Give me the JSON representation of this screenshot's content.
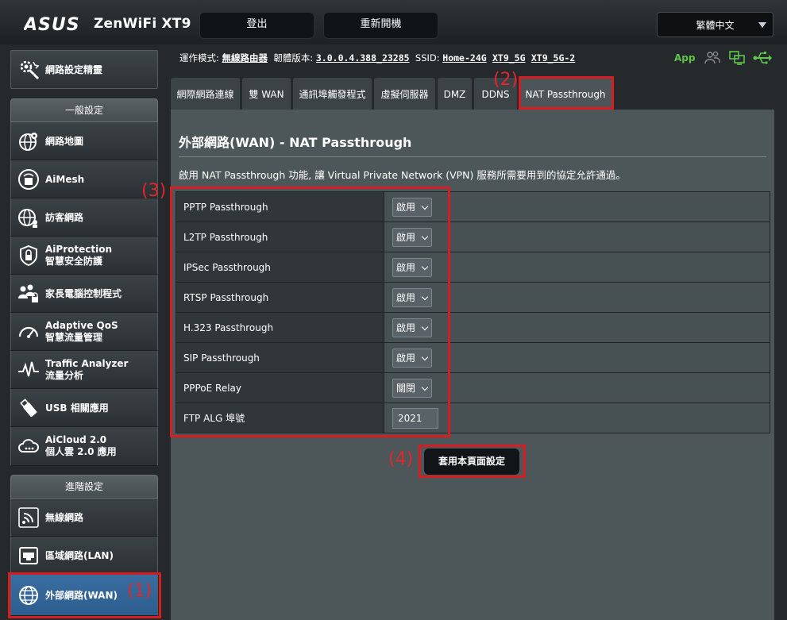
{
  "header": {
    "brand": "ASUS",
    "model": "ZenWiFi XT9",
    "logout_label": "登出",
    "reboot_label": "重新開機",
    "language": "繁體中文"
  },
  "info": {
    "mode_label": "運作模式:",
    "mode_value": "無線路由器",
    "firmware_label": "韌體版本:",
    "firmware_value": "3.0.0.4.388_23285",
    "ssid_label": "SSID:",
    "ssids": [
      "Home-24G",
      "XT9_5G",
      "XT9_5G-2"
    ],
    "app_label": "App"
  },
  "sidebar": {
    "quick_setup": "網路設定精靈",
    "general_heading": "一般設定",
    "general_items": [
      {
        "l1": "網路地圖",
        "l2": ""
      },
      {
        "l1": "AiMesh",
        "l2": ""
      },
      {
        "l1": "訪客網路",
        "l2": ""
      },
      {
        "l1": "AiProtection",
        "l2": "智慧安全防護"
      },
      {
        "l1": "家長電腦控制程式",
        "l2": ""
      },
      {
        "l1": "Adaptive QoS",
        "l2": "智慧流量管理"
      },
      {
        "l1": "Traffic Analyzer",
        "l2": "流量分析"
      },
      {
        "l1": "USB 相關應用",
        "l2": ""
      },
      {
        "l1": "AiCloud 2.0",
        "l2": "個人雲 2.0 應用"
      }
    ],
    "advanced_heading": "進階設定",
    "advanced_items": [
      {
        "l1": "無線網路",
        "l2": ""
      },
      {
        "l1": "區域網路(LAN)",
        "l2": ""
      },
      {
        "l1": "外部網路(WAN)",
        "l2": ""
      }
    ]
  },
  "tabs": [
    "網際網路連線",
    "雙 WAN",
    "通訊埠觸發程式",
    "虛擬伺服器",
    "DMZ",
    "DDNS",
    "NAT Passthrough"
  ],
  "main": {
    "title": "外部網路(WAN) - NAT Passthrough",
    "description": "啟用 NAT Passthrough 功能, 讓 Virtual Private Network (VPN) 服務所需要用到的協定允許通過。",
    "rows": [
      {
        "label": "PPTP Passthrough",
        "value": "啟用"
      },
      {
        "label": "L2TP Passthrough",
        "value": "啟用"
      },
      {
        "label": "IPSec Passthrough",
        "value": "啟用"
      },
      {
        "label": "RTSP Passthrough",
        "value": "啟用"
      },
      {
        "label": "H.323 Passthrough",
        "value": "啟用"
      },
      {
        "label": "SIP Passthrough",
        "value": "啟用"
      },
      {
        "label": "PPPoE Relay",
        "value": "關閉"
      }
    ],
    "ftp_label": "FTP ALG 埠號",
    "ftp_value": "2021",
    "apply_label": "套用本頁面設定"
  },
  "annotations": [
    "(1)",
    "(2)",
    "(3)",
    "(4)"
  ],
  "colors": {
    "highlight": "#d51d22",
    "active": "#2b5d8e",
    "app_green": "#5ec64a"
  }
}
